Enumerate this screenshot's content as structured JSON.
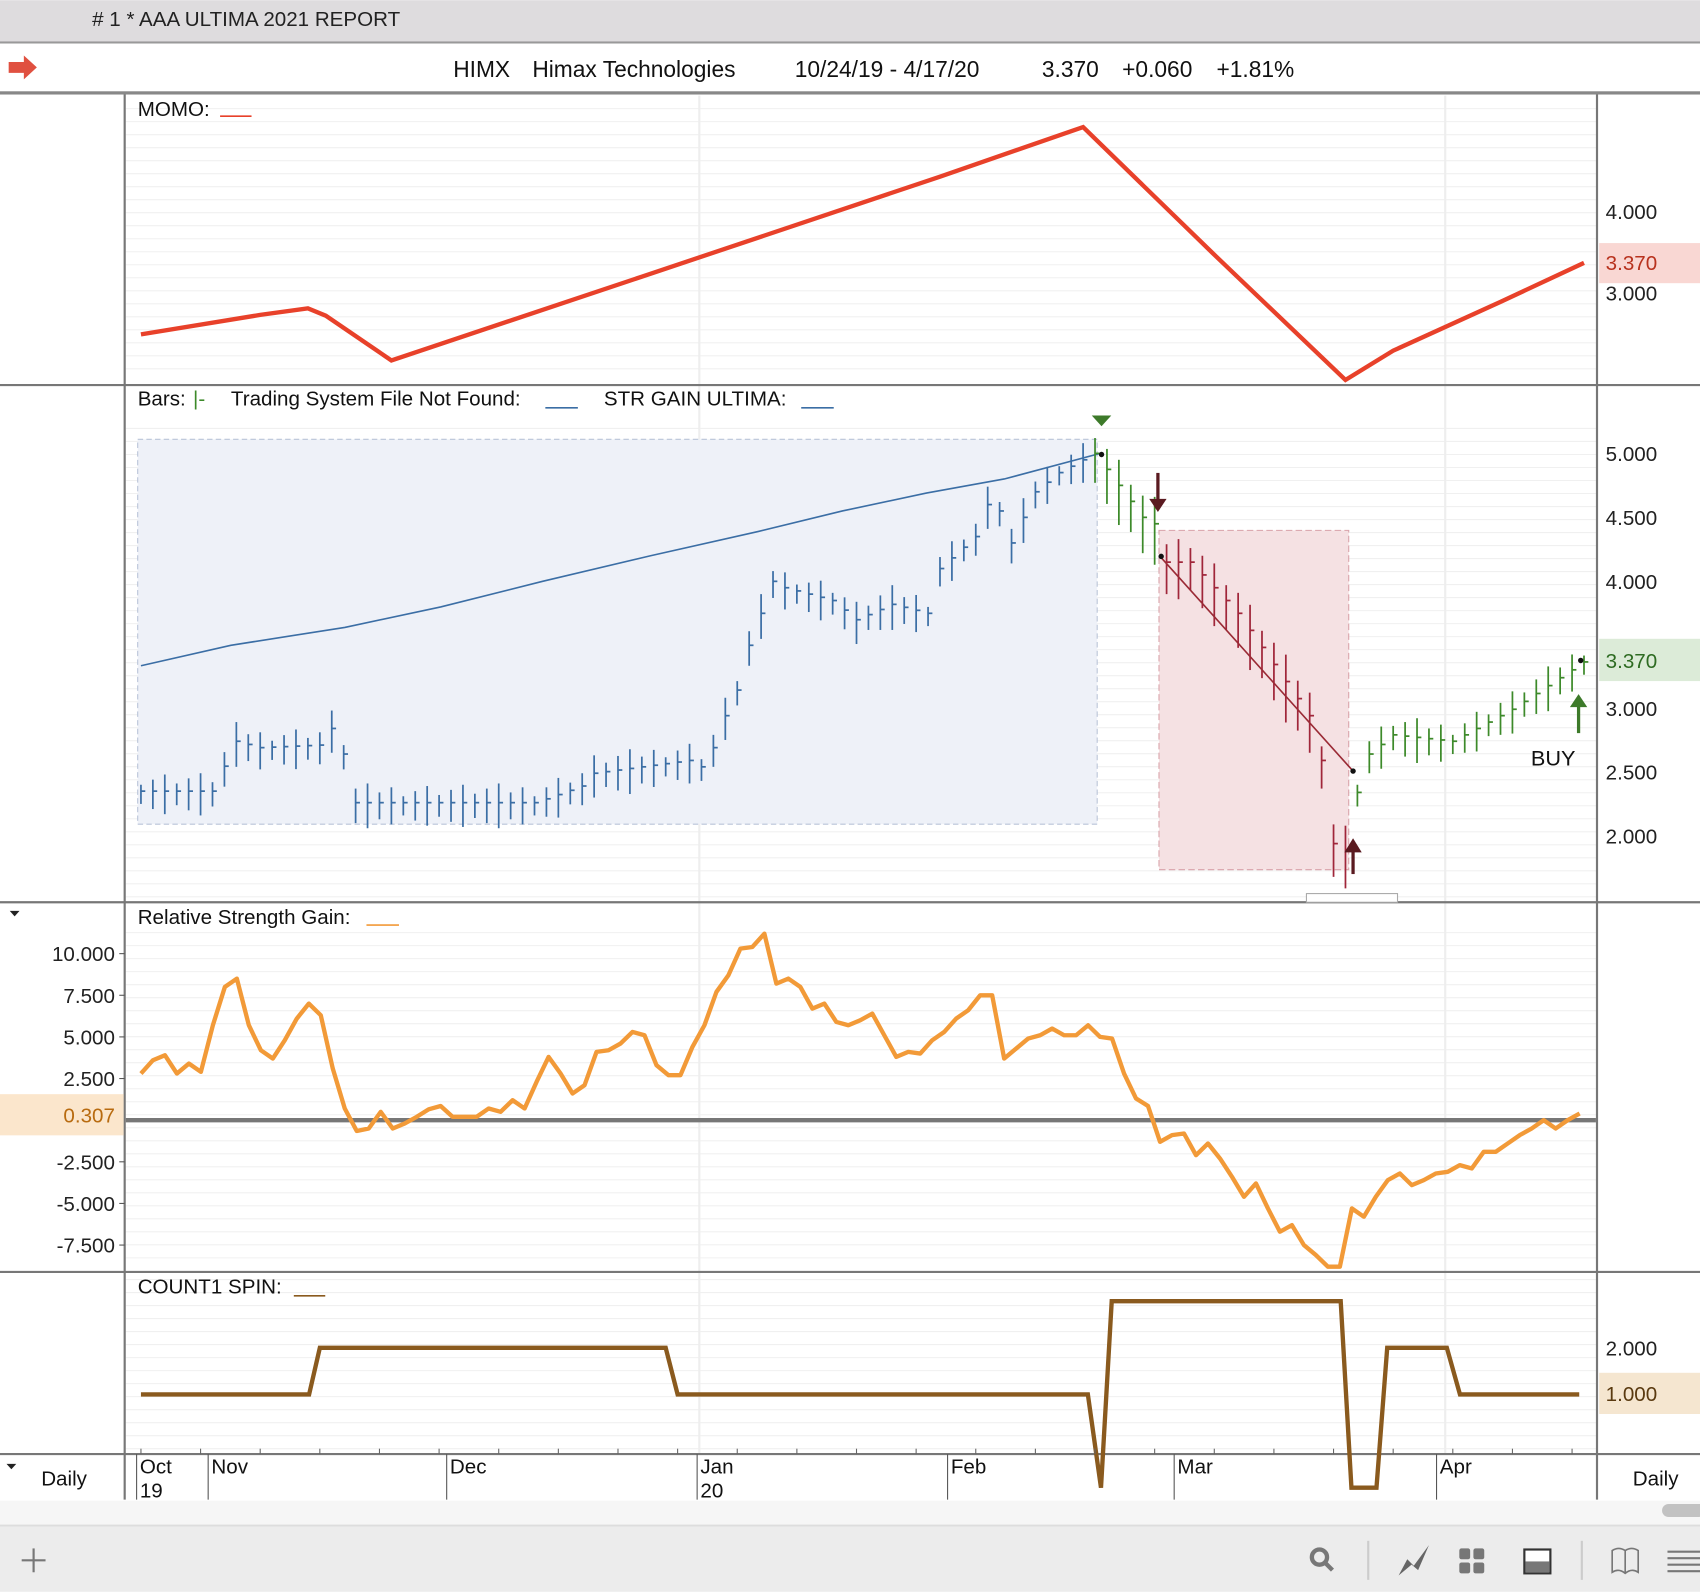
{
  "window": {
    "title": "# 1 * AAA ULTIMA  2021 REPORT"
  },
  "header": {
    "symbol": "HIMX",
    "company": "Himax Technologies",
    "date_range": "10/24/19 - 4/17/20",
    "last": "3.370",
    "change": "+0.060",
    "change_pct": "+1.81%"
  },
  "colors": {
    "momo": "#e8412a",
    "rsg": "#f29a38",
    "spin": "#8a5a1e",
    "bar_blue": "#3b6ea5",
    "bar_green": "#3d8a2a",
    "bar_red": "#a0263a"
  },
  "momo": {
    "label": "MOMO:",
    "axis": [
      "4.000",
      "3.000"
    ],
    "tag": "3.370",
    "points": [
      [
        0,
        2.49
      ],
      [
        10,
        2.73
      ],
      [
        14,
        2.81
      ],
      [
        15.5,
        2.72
      ],
      [
        21,
        2.17
      ],
      [
        42,
        3.2
      ],
      [
        67,
        4.43
      ],
      [
        79,
        5.04
      ],
      [
        90,
        3.47
      ],
      [
        101,
        1.93
      ],
      [
        105,
        2.29
      ],
      [
        114,
        2.89
      ],
      [
        121,
        3.37
      ]
    ]
  },
  "bars_panel": {
    "label_bars": "Bars:",
    "label_bars_sym": "|-",
    "label_tsf": "Trading System File Not Found:",
    "label_str": "STR GAIN ULTIMA:",
    "axis": [
      "5.000",
      "4.500",
      "4.000",
      "3.000",
      "2.500",
      "2.000"
    ],
    "tag": "3.370",
    "buy_label": "BUY",
    "ma_points": [
      [
        0,
        3.34
      ],
      [
        15,
        3.5
      ],
      [
        34,
        3.64
      ],
      [
        50,
        3.8
      ],
      [
        67,
        4.0
      ],
      [
        85,
        4.2
      ],
      [
        103,
        4.39
      ],
      [
        117,
        4.55
      ],
      [
        131,
        4.69
      ],
      [
        144,
        4.8
      ],
      [
        160,
        5.0
      ]
    ],
    "price_keypoints": [
      [
        0,
        2.36
      ],
      [
        6,
        2.36
      ],
      [
        8,
        2.75
      ],
      [
        10,
        2.7
      ],
      [
        15,
        2.72
      ],
      [
        16,
        2.85
      ],
      [
        17,
        2.65
      ],
      [
        18,
        2.27
      ],
      [
        33,
        2.27
      ],
      [
        34,
        2.3
      ],
      [
        37,
        2.4
      ],
      [
        38,
        2.5
      ],
      [
        46,
        2.6
      ],
      [
        47,
        2.55
      ],
      [
        48,
        2.7
      ],
      [
        49,
        2.95
      ],
      [
        50,
        3.15
      ],
      [
        51,
        3.5
      ],
      [
        52,
        3.75
      ],
      [
        53,
        4.0
      ],
      [
        54,
        3.95
      ],
      [
        58,
        3.85
      ],
      [
        60,
        3.7
      ],
      [
        63,
        3.82
      ],
      [
        66,
        3.75
      ],
      [
        67,
        4.1
      ],
      [
        70,
        4.35
      ],
      [
        71,
        4.6
      ],
      [
        72,
        4.55
      ],
      [
        73,
        4.3
      ],
      [
        74,
        4.5
      ],
      [
        75,
        4.7
      ],
      [
        77,
        4.85
      ],
      [
        80,
        5.0
      ],
      [
        84,
        4.5
      ],
      [
        85,
        4.45
      ],
      [
        86,
        4.15
      ],
      [
        88,
        4.15
      ],
      [
        92,
        3.75
      ],
      [
        95,
        3.35
      ],
      [
        98,
        2.95
      ],
      [
        99,
        2.6
      ],
      [
        100,
        1.95
      ],
      [
        101,
        1.9
      ],
      [
        102,
        2.35
      ],
      [
        103,
        2.65
      ],
      [
        105,
        2.8
      ],
      [
        110,
        2.75
      ],
      [
        115,
        3.0
      ],
      [
        121,
        3.37
      ]
    ]
  },
  "rsg": {
    "label": "Relative Strength Gain:",
    "axis": [
      "10.000",
      "7.500",
      "5.000",
      "2.500",
      "-2.500",
      "-5.000",
      "-7.500"
    ],
    "tag": "0.307",
    "values": [
      2.8,
      3.6,
      3.9,
      2.8,
      3.4,
      2.9,
      5.7,
      8.0,
      8.5,
      5.7,
      4.2,
      3.7,
      4.8,
      6.1,
      7.0,
      6.3,
      3.1,
      0.7,
      -0.65,
      -0.5,
      0.5,
      -0.5,
      -0.2,
      0.2,
      0.65,
      0.85,
      0.2,
      0.2,
      0.2,
      0.7,
      0.5,
      1.2,
      0.7,
      2.3,
      3.8,
      2.8,
      1.6,
      2.1,
      4.1,
      4.2,
      4.6,
      5.3,
      5.1,
      3.3,
      2.7,
      2.7,
      4.4,
      5.7,
      7.7,
      8.7,
      10.3,
      10.4,
      11.2,
      8.2,
      8.5,
      8.0,
      6.7,
      7.0,
      5.9,
      5.7,
      6.0,
      6.4,
      5.1,
      3.8,
      4.1,
      4.0,
      4.8,
      5.3,
      6.1,
      6.6,
      7.5,
      7.5,
      3.7,
      4.3,
      4.9,
      5.1,
      5.5,
      5.1,
      5.1,
      5.7,
      5.0,
      4.9,
      2.8,
      1.3,
      0.85,
      -1.3,
      -0.9,
      -0.8,
      -2.1,
      -1.4,
      -2.3,
      -3.4,
      -4.6,
      -3.8,
      -5.3,
      -6.7,
      -6.3,
      -7.5,
      -8.1,
      -8.8,
      -8.8,
      -5.3,
      -5.8,
      -4.6,
      -3.6,
      -3.2,
      -3.9,
      -3.6,
      -3.2,
      -3.1,
      -2.7,
      -2.9,
      -1.9,
      -1.9,
      -1.4,
      -0.9,
      -0.5,
      0.0,
      -0.5,
      0.0,
      0.4
    ]
  },
  "spin": {
    "label": "COUNT1 SPIN:",
    "axis": [
      "2.000"
    ],
    "tag": "1.000",
    "points": [
      [
        0,
        1
      ],
      [
        14.1,
        1
      ],
      [
        15,
        2
      ],
      [
        44,
        2
      ],
      [
        45,
        1
      ],
      [
        79.4,
        1
      ],
      [
        80.5,
        -1
      ],
      [
        81.4,
        3
      ],
      [
        100.6,
        3
      ],
      [
        101.5,
        -1
      ],
      [
        103.6,
        -1
      ],
      [
        104.5,
        2
      ],
      [
        109.5,
        2
      ],
      [
        110.6,
        1
      ],
      [
        120.6,
        1
      ]
    ]
  },
  "date_axis": {
    "period_left": "Daily",
    "period_right": "Daily",
    "months": [
      {
        "m": "Oct",
        "y": "19",
        "day": 0
      },
      {
        "m": "Nov",
        "y": "",
        "day": 6
      },
      {
        "m": "Dec",
        "y": "",
        "day": 26
      },
      {
        "m": "Jan",
        "y": "20",
        "day": 47
      },
      {
        "m": "Feb",
        "y": "",
        "day": 68
      },
      {
        "m": "Mar",
        "y": "",
        "day": 87
      },
      {
        "m": "Apr",
        "y": "",
        "day": 109
      }
    ]
  },
  "toolbar": {
    "icons": [
      "plus-icon",
      "search-icon",
      "chart-line-icon",
      "grid-icon",
      "panel-icon",
      "book-icon",
      "menu-icon"
    ]
  }
}
